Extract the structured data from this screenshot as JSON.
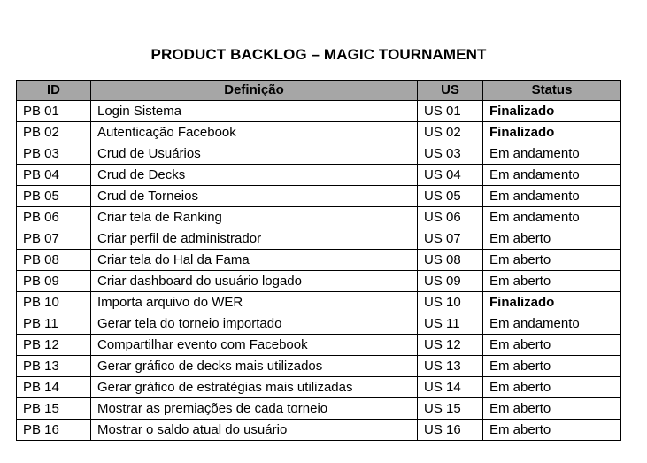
{
  "document": {
    "title": "PRODUCT BACKLOG – MAGIC TOURNAMENT"
  },
  "table": {
    "headers": {
      "id": "ID",
      "definition": "Definição",
      "us": "US",
      "status": "Status"
    },
    "rows": [
      {
        "id": "PB 01",
        "definition": "Login Sistema",
        "us": "US 01",
        "status": "Finalizado"
      },
      {
        "id": "PB 02",
        "definition": "Autenticação Facebook",
        "us": "US 02",
        "status": "Finalizado"
      },
      {
        "id": "PB 03",
        "definition": "Crud de Usuários",
        "us": "US 03",
        "status": "Em andamento"
      },
      {
        "id": "PB 04",
        "definition": "Crud de Decks",
        "us": "US 04",
        "status": "Em andamento"
      },
      {
        "id": "PB 05",
        "definition": "Crud de Torneios",
        "us": "US 05",
        "status": "Em andamento"
      },
      {
        "id": "PB 06",
        "definition": "Criar tela de Ranking",
        "us": "US 06",
        "status": "Em andamento"
      },
      {
        "id": "PB 07",
        "definition": "Criar perfil de administrador",
        "us": "US 07",
        "status": "Em aberto"
      },
      {
        "id": "PB 08",
        "definition": "Criar tela do Hal da Fama",
        "us": "US 08",
        "status": "Em aberto"
      },
      {
        "id": "PB 09",
        "definition": "Criar dashboard do usuário logado",
        "us": "US 09",
        "status": "Em aberto"
      },
      {
        "id": "PB 10",
        "definition": "Importa arquivo do WER",
        "us": "US 10",
        "status": "Finalizado"
      },
      {
        "id": "PB 11",
        "definition": "Gerar tela do torneio importado",
        "us": "US 11",
        "status": "Em andamento"
      },
      {
        "id": "PB 12",
        "definition": "Compartilhar evento com Facebook",
        "us": "US 12",
        "status": "Em aberto"
      },
      {
        "id": "PB 13",
        "definition": "Gerar gráfico de decks mais utilizados",
        "us": "US 13",
        "status": "Em aberto"
      },
      {
        "id": "PB 14",
        "definition": "Gerar gráfico de estratégias mais utilizadas",
        "us": "US 14",
        "status": "Em aberto"
      },
      {
        "id": "PB 15",
        "definition": "Mostrar as premiações de cada torneio",
        "us": "US 15",
        "status": "Em aberto"
      },
      {
        "id": "PB 16",
        "definition": "Mostrar o saldo atual do usuário",
        "us": "US 16",
        "status": "Em aberto"
      }
    ]
  },
  "styles": {
    "header_background": "#a6a6a6",
    "border_color": "#000000",
    "bold_status": "Finalizado"
  }
}
